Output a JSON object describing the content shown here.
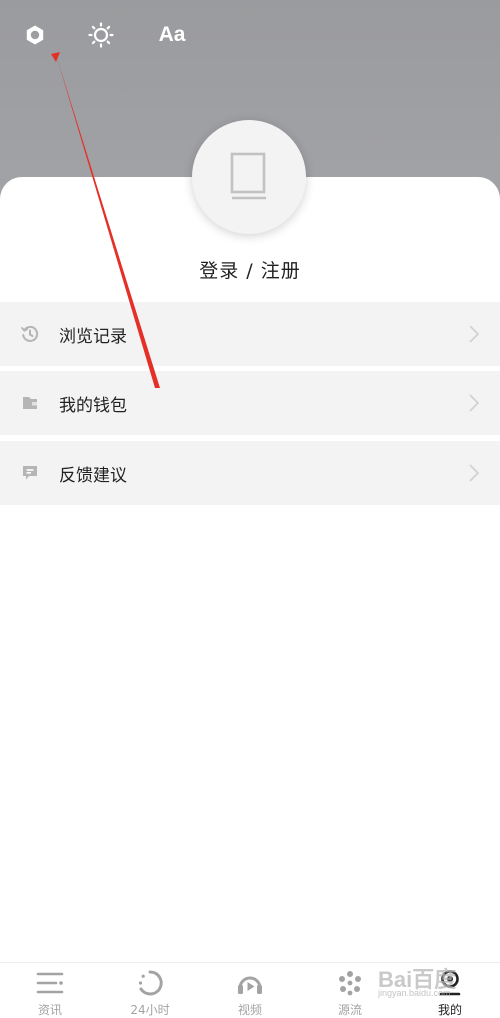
{
  "top_bar": {
    "settings_icon": "gear-icon",
    "brightness_icon": "sun-icon",
    "font_label": "Aa"
  },
  "profile": {
    "avatar_icon": "avatar-placeholder-icon",
    "login_label": "登录 / 注册"
  },
  "menu": [
    {
      "icon": "history-icon",
      "label": "浏览记录"
    },
    {
      "icon": "wallet-icon",
      "label": "我的钱包"
    },
    {
      "icon": "feedback-icon",
      "label": "反馈建议"
    }
  ],
  "tabbar": [
    {
      "icon": "news-icon",
      "label": "资讯",
      "active": false
    },
    {
      "icon": "clock-24h-icon",
      "label": "24小时",
      "active": false
    },
    {
      "icon": "video-icon",
      "label": "视频",
      "active": false
    },
    {
      "icon": "source-icon",
      "label": "源流",
      "active": false
    },
    {
      "icon": "profile-icon",
      "label": "我的",
      "active": true
    }
  ],
  "watermark": {
    "logo": "Bai百度",
    "url": "jingyan.baidu.com"
  },
  "colors": {
    "header_bg": "#9a9b9e",
    "menu_bg": "#f3f3f3",
    "annotation_arrow": "#e53027",
    "tab_inactive": "#a3a3a3",
    "tab_active": "#222222"
  }
}
